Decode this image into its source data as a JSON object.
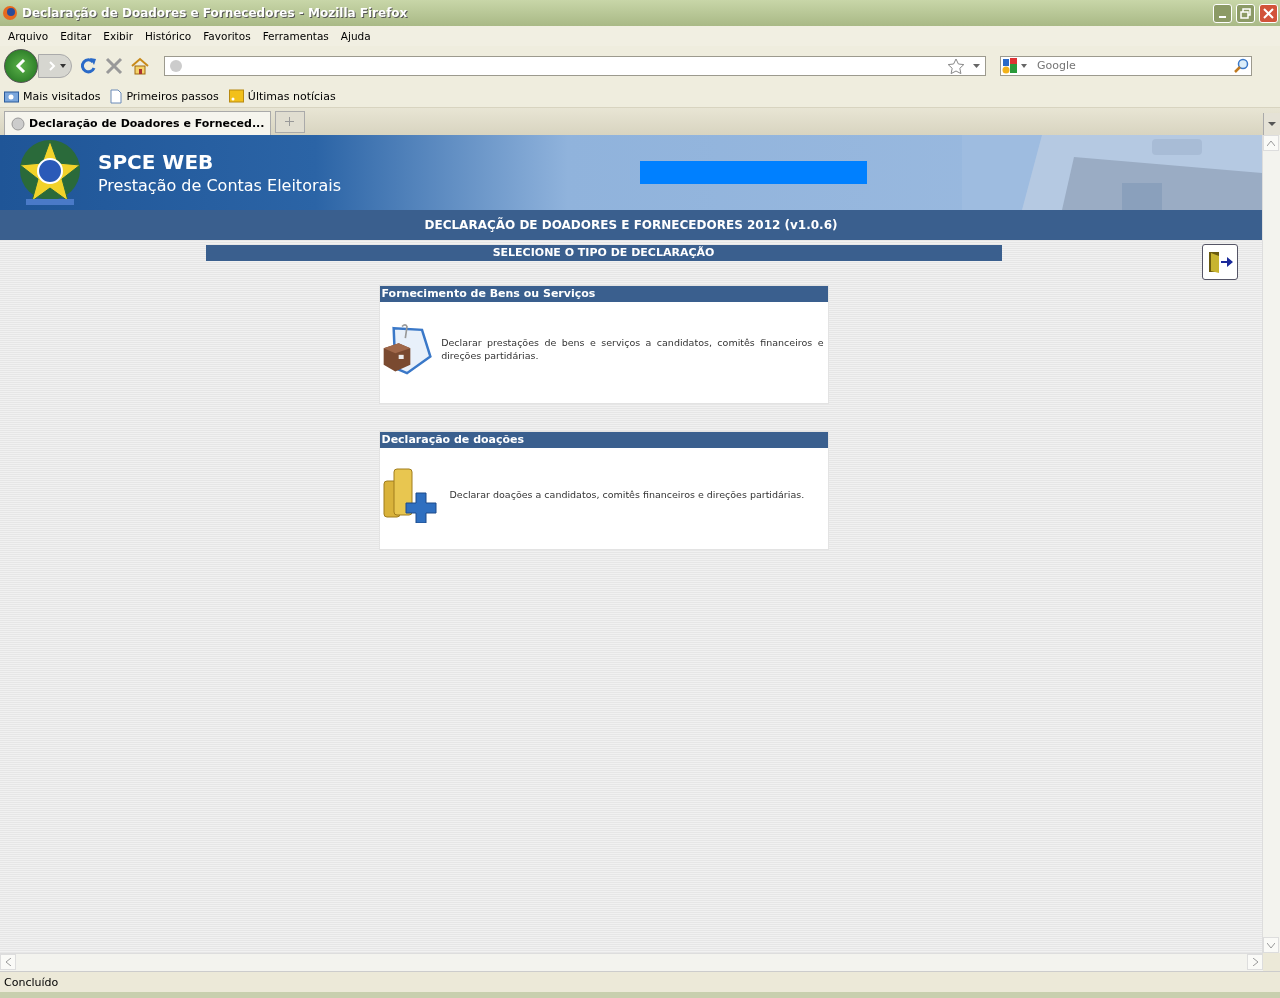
{
  "window": {
    "title": "Declaração de Doadores e Fornecedores - Mozilla Firefox"
  },
  "menu": [
    "Arquivo",
    "Editar",
    "Exibir",
    "Histórico",
    "Favoritos",
    "Ferramentas",
    "Ajuda"
  ],
  "search": {
    "placeholder": "Google"
  },
  "bookmarks": [
    "Mais visitados",
    "Primeiros passos",
    "Últimas notícias"
  ],
  "tabs": [
    {
      "label": "Declaração de Doadores e Forneced...",
      "selected": true
    }
  ],
  "header": {
    "title": "SPCE WEB",
    "subtitle": "Prestação de Contas Eleitorais"
  },
  "page_title": "DECLARAÇÃO DE DOADORES E FORNECEDORES 2012 (v1.0.6)",
  "section_title": "SELECIONE O TIPO DE DECLARAÇÃO",
  "options": [
    {
      "kind": "supply",
      "title": "Fornecimento de Bens ou Serviços",
      "description": "Declarar prestações de bens e serviços a candidatos, comitês financeiros e direções partidárias."
    },
    {
      "kind": "donation",
      "title": "Declaração de doações",
      "description": "Declarar doações a candidatos, comitês financeiros e direções partidárias."
    }
  ],
  "status_bar": "Concluído"
}
